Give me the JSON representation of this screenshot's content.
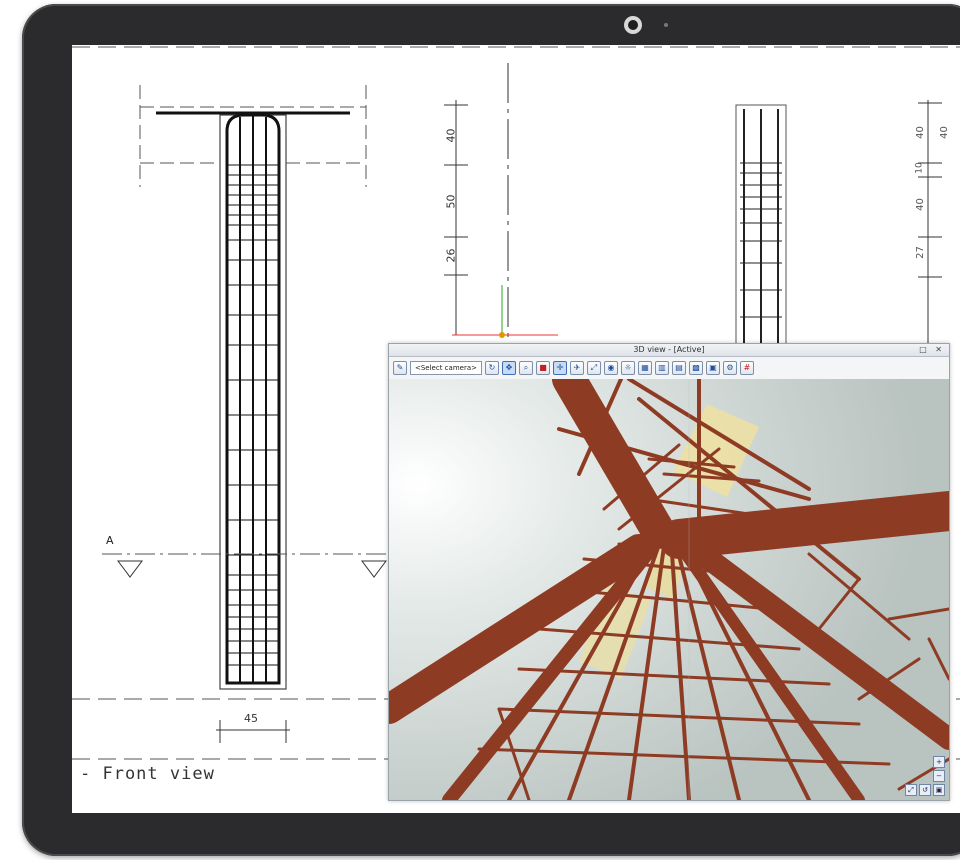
{
  "drawing": {
    "front_view_label": "- Front view",
    "section_marker": "A",
    "dims_left": [
      "40",
      "50",
      "26"
    ],
    "dims_right": [
      "40",
      "40",
      "40",
      "27"
    ],
    "dims_right_small": [
      "40",
      "10"
    ],
    "bottom_dim": "45"
  },
  "view3d": {
    "title": "3D view - [Active]",
    "window_buttons": "□ ✕",
    "camera_select": "<Select camera>",
    "toolbar_icons": [
      "paint-icon",
      "select-camera-dropdown",
      "orbit-icon",
      "pan-icon",
      "zoom-icon",
      "render-icon",
      "move-icon",
      "fly-icon",
      "walk-icon",
      "camera-icon",
      "lights-icon",
      "materials-icon",
      "section-icon",
      "layers-icon",
      "grid-icon",
      "snapshot-icon",
      "settings-icon",
      "rebar-icon"
    ],
    "corner_buttons": [
      "zoom-in-icon",
      "zoom-out-icon",
      "fit-icon",
      "reset-icon",
      "screenshot-icon"
    ]
  },
  "colors": {
    "bezel": "#2b2b2d",
    "steel": "#8e3b24",
    "sky": "#cfd6d3",
    "platform": "#e6dca0"
  }
}
